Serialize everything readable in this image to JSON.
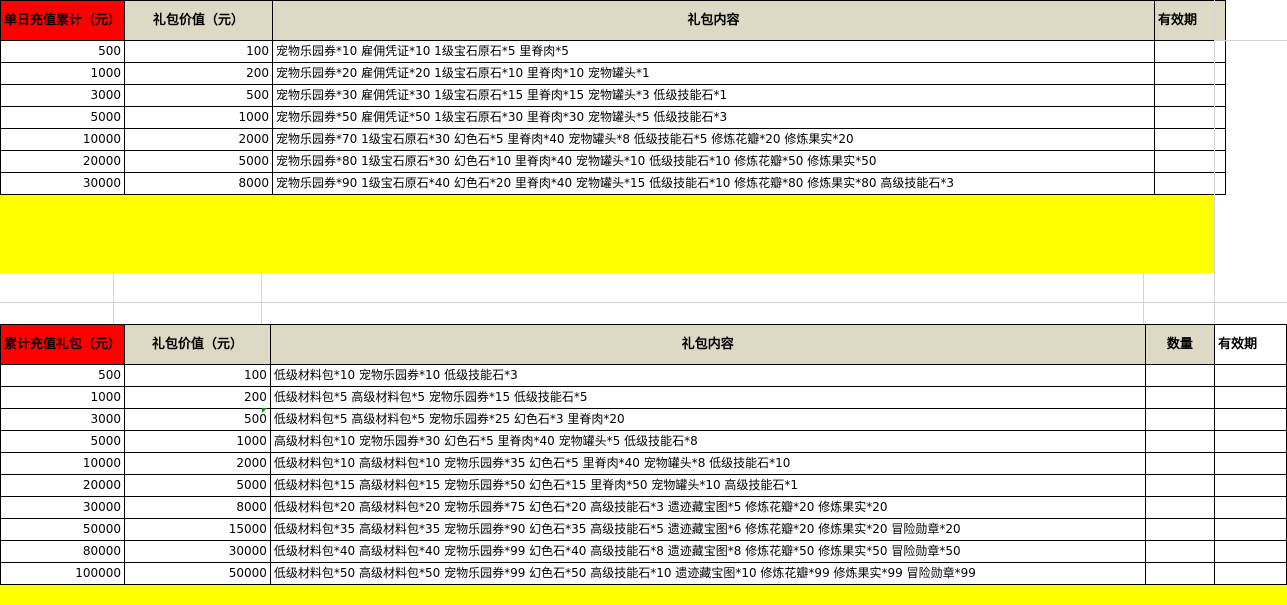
{
  "table1": {
    "headers": [
      "单日充值累计（元）",
      "礼包价值（元）",
      "礼包内容",
      "有效期"
    ],
    "rows": [
      {
        "amount": "500",
        "value": "100",
        "content": "宠物乐园券*10 雇佣凭证*10 1级宝石原石*5 里脊肉*5"
      },
      {
        "amount": "1000",
        "value": "200",
        "content": "宠物乐园券*20 雇佣凭证*20 1级宝石原石*10 里脊肉*10 宠物罐头*1"
      },
      {
        "amount": "3000",
        "value": "500",
        "content": "宠物乐园券*30 雇佣凭证*30 1级宝石原石*15 里脊肉*15 宠物罐头*3 低级技能石*1"
      },
      {
        "amount": "5000",
        "value": "1000",
        "content": "宠物乐园券*50 雇佣凭证*50 1级宝石原石*30 里脊肉*30 宠物罐头*5 低级技能石*3"
      },
      {
        "amount": "10000",
        "value": "2000",
        "content": "宠物乐园券*70 1级宝石原石*30 幻色石*5 里脊肉*40 宠物罐头*8 低级技能石*5 修炼花瓣*20 修炼果实*20"
      },
      {
        "amount": "20000",
        "value": "5000",
        "content": "宠物乐园券*80 1级宝石原石*30 幻色石*10 里脊肉*40 宠物罐头*10 低级技能石*10 修炼花瓣*50 修炼果实*50"
      },
      {
        "amount": "30000",
        "value": "8000",
        "content": "宠物乐园券*90 1级宝石原石*40 幻色石*20 里脊肉*40 宠物罐头*15 低级技能石*10 修炼花瓣*80 修炼果实*80 高级技能石*3"
      }
    ]
  },
  "table2": {
    "headers": [
      "累计充值礼包（元）",
      "礼包价值（元）",
      "礼包内容",
      "数量",
      "有效期"
    ],
    "rows": [
      {
        "amount": "500",
        "value": "100",
        "content": "低级材料包*10 宠物乐园券*10 低级技能石*3"
      },
      {
        "amount": "1000",
        "value": "200",
        "content": "低级材料包*5 高级材料包*5 宠物乐园券*15 低级技能石*5"
      },
      {
        "amount": "3000",
        "value": "500",
        "content": "低级材料包*5 高级材料包*5 宠物乐园券*25 幻色石*3 里脊肉*20"
      },
      {
        "amount": "5000",
        "value": "1000",
        "content": "高级材料包*10 宠物乐园券*30 幻色石*5 里脊肉*40 宠物罐头*5 低级技能石*8"
      },
      {
        "amount": "10000",
        "value": "2000",
        "content": "低级材料包*10 高级材料包*10 宠物乐园券*35 幻色石*5 里脊肉*40 宠物罐头*8 低级技能石*10"
      },
      {
        "amount": "20000",
        "value": "5000",
        "content": "低级材料包*15 高级材料包*15 宠物乐园券*50 幻色石*15 里脊肉*50 宠物罐头*10 高级技能石*1"
      },
      {
        "amount": "30000",
        "value": "8000",
        "content": "低级材料包*20 高级材料包*20 宠物乐园券*75 幻色石*20 高级技能石*3 遗迹藏宝图*5 修炼花瓣*20 修炼果实*20"
      },
      {
        "amount": "50000",
        "value": "15000",
        "content": "低级材料包*35 高级材料包*35 宠物乐园券*90 幻色石*35 高级技能石*5 遗迹藏宝图*6 修炼花瓣*20 修炼果实*20 冒险勋章*20"
      },
      {
        "amount": "80000",
        "value": "30000",
        "content": "低级材料包*40 高级材料包*40 宠物乐园券*99 幻色石*40 高级技能石*8 遗迹藏宝图*8 修炼花瓣*50 修炼果实*50 冒险勋章*50"
      },
      {
        "amount": "100000",
        "value": "50000",
        "content": "低级材料包*50 高级材料包*50 宠物乐园券*99 幻色石*50 高级技能石*10 遗迹藏宝图*10 修炼花瓣*99 修炼果实*99 冒险勋章*99"
      }
    ]
  },
  "colors": {
    "header_red": "#ff0000",
    "header_tan": "#ddd9c4",
    "highlight_yellow": "#ffff00"
  }
}
